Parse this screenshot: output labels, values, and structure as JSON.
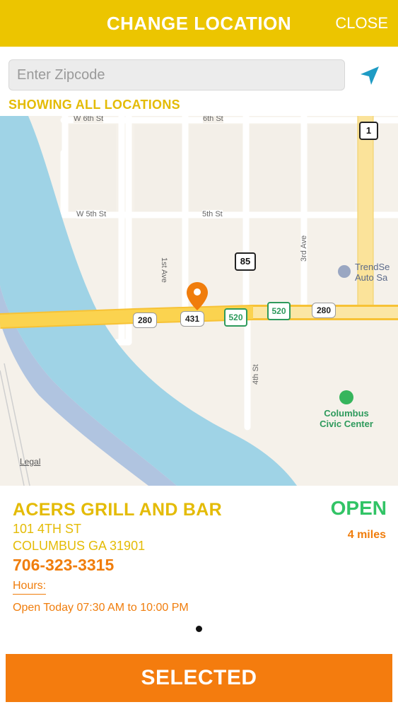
{
  "header": {
    "title": "CHANGE LOCATION",
    "close_label": "CLOSE"
  },
  "search": {
    "placeholder": "Enter Zipcode",
    "value": "",
    "locate_icon": "location-arrow-icon",
    "filter_label": "SHOWING ALL LOCATIONS"
  },
  "map": {
    "streets": {
      "w6th": "W 6th St",
      "6th": "6th St",
      "w5th": "W 5th St",
      "5th": "5th St",
      "1st_ave": "1st Ave",
      "3rd_ave": "3rd Ave",
      "4th_st": "4th St"
    },
    "shields": {
      "us1": "1",
      "us85": "85",
      "us280_left": "280",
      "us431": "431",
      "sr520_a": "520",
      "sr520_b": "520",
      "us280_right": "280"
    },
    "poi": {
      "trendset_line1": "TrendSe",
      "trendset_line2": "Auto Sa",
      "civic_line1": "Columbus",
      "civic_line2": "Civic Center"
    },
    "legal_label": "Legal",
    "colors": {
      "land": "#f5f1ea",
      "river": "#9fd3e6",
      "highway": "#f9d24e",
      "street": "#ffffff",
      "pin": "#f07d0c"
    }
  },
  "location": {
    "name": "ACERS GRILL AND BAR",
    "address_line1": "101 4TH ST",
    "address_line2": "COLUMBUS GA 31901",
    "phone": "706-323-3315",
    "hours_label": "Hours:",
    "hours_text": "Open Today 07:30 AM to 10:00 PM",
    "status": "OPEN",
    "distance": "4 miles"
  },
  "pagination": {
    "current": 1,
    "total": 1
  },
  "actions": {
    "selected_label": "SELECTED"
  },
  "colors": {
    "brand_yellow": "#ecc500",
    "accent_orange": "#f47c0e",
    "open_green": "#32c466"
  }
}
